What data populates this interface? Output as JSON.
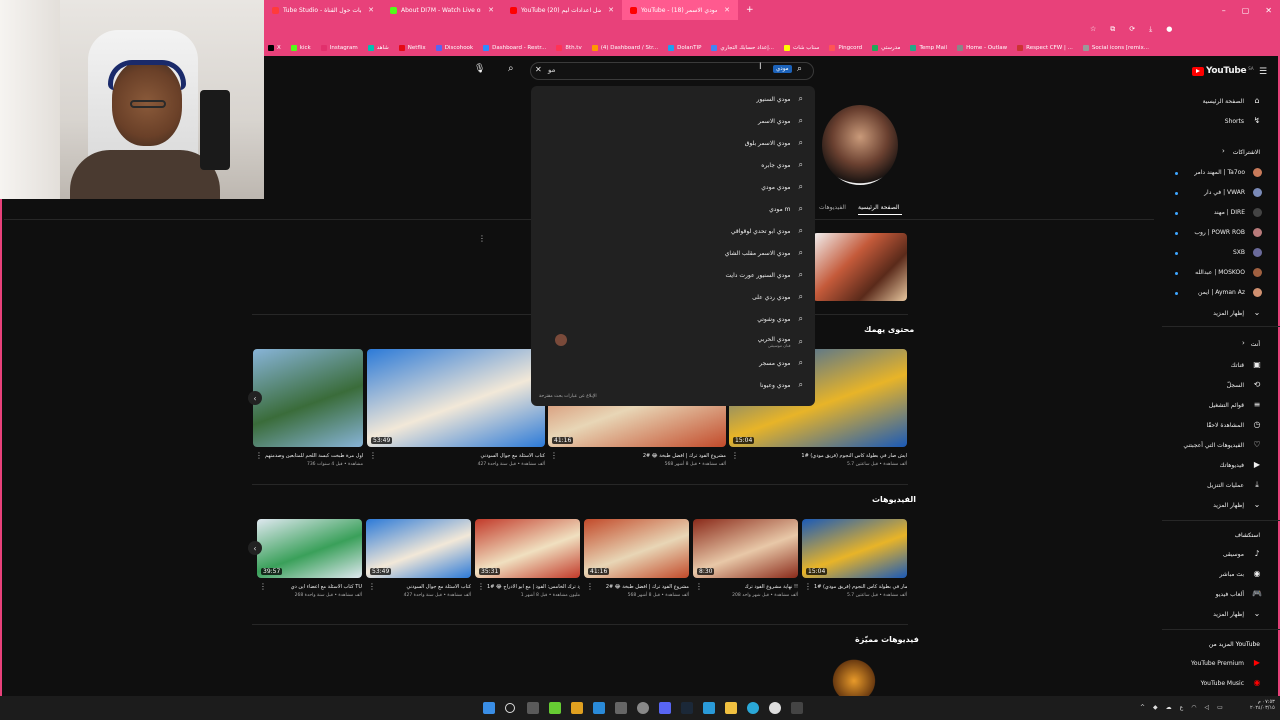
{
  "tabs": [
    {
      "label": "Tube Studio - إحصائيات حول القناة",
      "color": "#ff3b3b"
    },
    {
      "label": "About DI7M - Watch Live on Kick",
      "color": "#53fc18"
    },
    {
      "label": "YouTube (20) أفضل اعدادات ليم 😂",
      "color": "#ff0000"
    },
    {
      "label": "YouTube - (18) مودي الاسمر",
      "color": "#ff0000",
      "active": true
    }
  ],
  "bookmarks": [
    {
      "label": "X",
      "color": "#000000"
    },
    {
      "label": "kick",
      "color": "#53fc18"
    },
    {
      "label": "Instagram",
      "color": "#e1306c"
    },
    {
      "label": "شاهد",
      "color": "#00c2b2"
    },
    {
      "label": "Netflix",
      "color": "#e50914"
    },
    {
      "label": "Discohook",
      "color": "#5865f2"
    },
    {
      "label": "Dashboard - Restr...",
      "color": "#2d8cff"
    },
    {
      "label": "8th.tv",
      "color": "#ff3355"
    },
    {
      "label": "(4) Dashboard / Str...",
      "color": "#ff9900"
    },
    {
      "label": "DolanTIP",
      "color": "#1da1f2"
    },
    {
      "label": "إعداد حسابك التجاري...",
      "color": "#4285f4"
    },
    {
      "label": "سناب شات",
      "color": "#fffc00"
    },
    {
      "label": "Pingcord",
      "color": "#ff5555"
    },
    {
      "label": "مدرستي",
      "color": "#1faa59"
    },
    {
      "label": "Temp Mail",
      "color": "#22aa88"
    },
    {
      "label": "Home - Outlaw",
      "color": "#888888"
    },
    {
      "label": "Respect CFW | ...",
      "color": "#cc3333"
    },
    {
      "label": "Social icons [remix...",
      "color": "#999999"
    }
  ],
  "search": {
    "query": "مو",
    "chip": "مودي"
  },
  "suggestions": [
    "مودي السنيور",
    "مودي الاسمر",
    "مودي الاسمر بلوق",
    "مودي جابره",
    "مودي مودي",
    "مودي m",
    "مودي ابو تحدي لوقواقي",
    "مودي الاسمر مقلب الشاي",
    "مودي السنيور عورت دايت",
    "مودي ردي على",
    "مودي وشوتي",
    "مودي الحربي",
    "مودي مسجر",
    "مودي وعيونا"
  ],
  "suggestion_sub": "فنان موسيقي",
  "suggest_note": "الإبلاغ عن عبارات بحث مقترحة",
  "channel_tabs": {
    "home": "الصفحة الرئيسية",
    "videos": "الفيديوهات"
  },
  "sections": {
    "for_you": "محتوى يهمك",
    "videos": "الفيديوهات",
    "featured": "فيديوهات مميّزة"
  },
  "for_you_videos": [
    {
      "title": "أول مرة طبخت كبسة اللحم للمتابعين وصدمتهم",
      "meta": "736 مشاهدة • قبل 4 سنوات",
      "duration": "",
      "color1": "#88b4d8",
      "color2": "#3a6c3a"
    },
    {
      "title": "كتاب الاسئلة مع جوال السودني",
      "meta": "427 ألف مشاهدة • قبل سنة واحدة",
      "duration": "53:49",
      "color1": "#2c7ad8",
      "color2": "#f2e8d8"
    },
    {
      "title": "مشروع الفود ترك | أفضل طبخة 😂 #2",
      "meta": "568 ألف مشاهدة • قبل 8 أشهر",
      "duration": "41:16",
      "color1": "#c24a2a",
      "color2": "#e8d6b6"
    },
    {
      "title": "ايش صار في بطولة كأس النجوم (فريق مودي) #1",
      "meta": "5.7 ألف مشاهدة • قبل ساعتين",
      "duration": "15:04",
      "color1": "#1a5ab8",
      "color2": "#e8b428"
    }
  ],
  "videos": [
    {
      "title": "كتاب الاسئلة مع اعضاء اين دي TU",
      "meta": "268 ألف مشاهدة • قبل سنة واحدة",
      "duration": "39:57",
      "color1": "#dfe8f0",
      "color2": "#3aa05a"
    },
    {
      "title": "كتاب الاسئلة مع جوال السودني",
      "meta": "427 ألف مشاهدة • قبل سنة واحدة",
      "duration": "53:49",
      "color1": "#2c7ad8",
      "color2": "#f2e8d8"
    },
    {
      "title": "مشروع الفود ترك الخامس: الفود | مع ابو الادراج 😂 #1",
      "meta": "1 مليون مشاهدة • قبل 8 أشهر",
      "duration": "35:31",
      "color1": "#c23a2a",
      "color2": "#f0e0c0"
    },
    {
      "title": "مشروع الفود ترك | أفضل طبخة 😂 #2",
      "meta": "568 ألف مشاهدة • قبل 8 أشهر",
      "duration": "41:16",
      "color1": "#c24a2a",
      "color2": "#e8d6b6"
    },
    {
      "title": "نهاية مشروع الفود ترك !!",
      "meta": "208 ألف مشاهدة • قبل شهر واحد",
      "duration": "8:30",
      "color1": "#8a2a1a",
      "color2": "#e8c8a8"
    },
    {
      "title": "ايش صار في بطولة كأس النجوم (فريق مودي) #1",
      "meta": "5.7 ألف مشاهدة • قبل ساعتين",
      "duration": "15:04",
      "color1": "#1a5ab8",
      "color2": "#e8b428"
    }
  ],
  "sidebar": {
    "logo": "YouTube",
    "logo_sup": "SA",
    "home": "الصفحة الرئيسية",
    "shorts": "Shorts",
    "subscriptions": "الاشتراكات",
    "channels": [
      {
        "name": "المهند دامر | Ta7oo",
        "color": "#c87a5a",
        "dot": true
      },
      {
        "name": "في دار | VWAR",
        "color": "#7a8ab8",
        "dot": true
      },
      {
        "name": "مهند | DIRE",
        "color": "#444444",
        "dot": true
      },
      {
        "name": "روب | POWR ROB",
        "color": "#b87a7a",
        "dot": true
      },
      {
        "name": "SXB",
        "color": "#6a6a9a",
        "dot": true
      },
      {
        "name": "عبدالله | MOSKOO",
        "color": "#a06040",
        "dot": true
      },
      {
        "name": "ايمن | Ayman Az",
        "color": "#d09070",
        "dot": true
      }
    ],
    "show_more": "إظهار المزيد",
    "you": "أنت",
    "you_items": [
      "قناتك",
      "السجلّ",
      "قوائم التشغيل",
      "المشاهدة لاحقًا",
      "الفيديوهات التي أعجبتني",
      "فيديوهاتك",
      "عمليات التنزيل"
    ],
    "show_more2": "إظهار المزيد",
    "explore": "استكشاف",
    "explore_items": [
      "موسيقى",
      "بث مباشر",
      "ألعاب فيديو"
    ],
    "show_more3": "إظهار المزيد",
    "more_from": "المزيد من YouTube",
    "premium": "YouTube Premium",
    "music": "YouTube Music"
  },
  "taskbar": {
    "time": "٠٧:٥٣ م",
    "date": "٢٠٢٤/٠٣/١٥"
  }
}
